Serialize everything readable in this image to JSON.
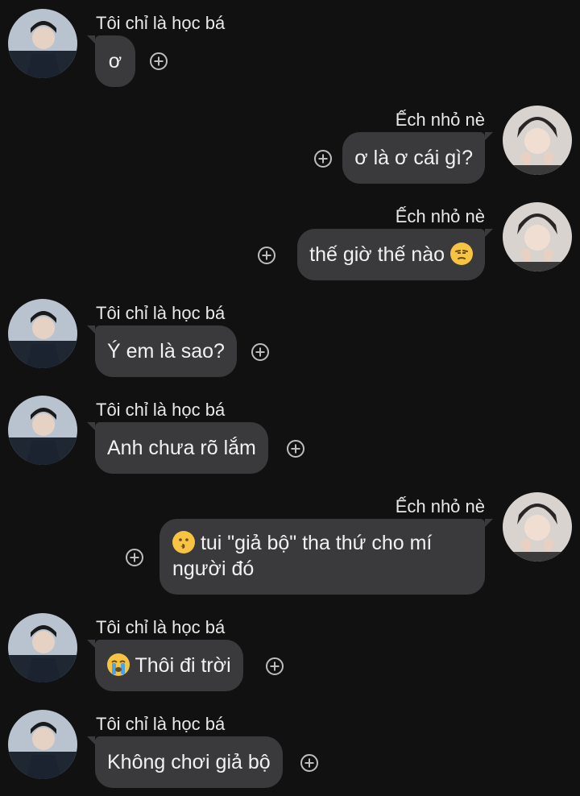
{
  "messages": [
    {
      "side": "left",
      "sender": "Tôi chỉ là học bá",
      "text": "ơ"
    },
    {
      "side": "right",
      "sender": "Ếch nhỏ nè",
      "text": "ơ là ơ cái gì?"
    },
    {
      "side": "right",
      "sender": "Ếch nhỏ nè",
      "text": "thế giờ thế nào",
      "emoji": "unamused-emoji"
    },
    {
      "side": "left",
      "sender": "Tôi chỉ là học bá",
      "text": "Ý em là sao?"
    },
    {
      "side": "left",
      "sender": "Tôi chỉ là học bá",
      "text": "Anh chưa rõ lắm"
    },
    {
      "side": "right",
      "sender": "Ếch nhỏ nè",
      "emoji": "kissing-emoji",
      "text_line1": "tui \"giả bộ\" tha thứ cho mí",
      "text_line2": "người đó"
    },
    {
      "side": "left",
      "sender": "Tôi chỉ là học bá",
      "emoji": "loudly-crying-emoji",
      "text": "Thôi đi trời"
    },
    {
      "side": "left",
      "sender": "Tôi chỉ là học bá",
      "text": "Không chơi giả bộ"
    }
  ],
  "colors": {
    "background": "#111112",
    "bubble": "#3a3a3c",
    "text": "#f1f1f1",
    "plus_icon": "#bdbdbd"
  }
}
